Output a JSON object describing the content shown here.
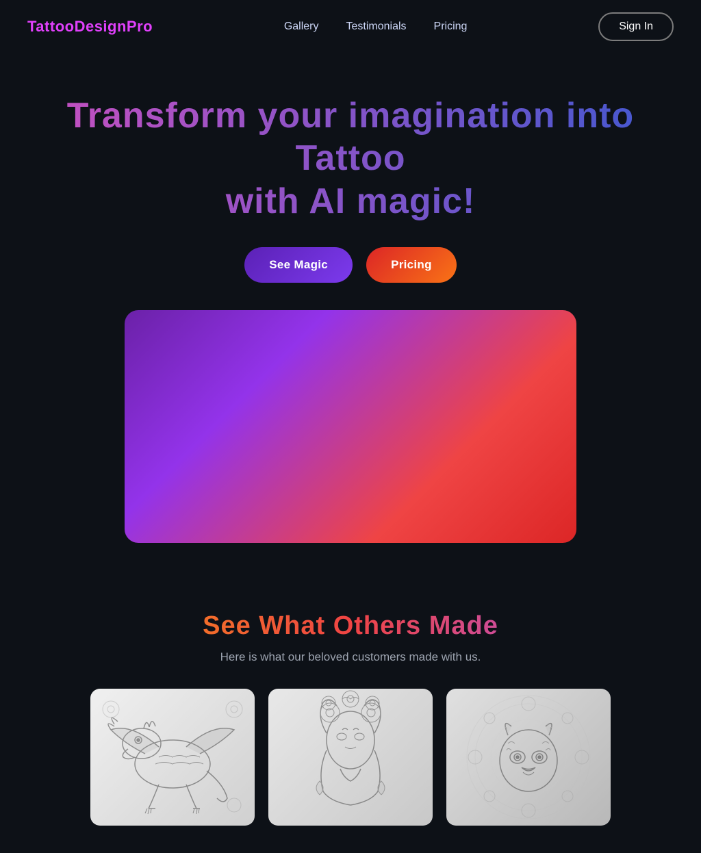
{
  "nav": {
    "logo": "TattooDesignPro",
    "links": [
      {
        "label": "Gallery",
        "href": "#gallery"
      },
      {
        "label": "Testimonials",
        "href": "#testimonials"
      },
      {
        "label": "Pricing",
        "href": "#pricing"
      }
    ],
    "signin_label": "Sign In"
  },
  "hero": {
    "title_line1": "Transform your imagination into Tattoo",
    "title_line2": "with AI magic!",
    "btn_magic": "See Magic",
    "btn_pricing": "Pricing"
  },
  "gallery": {
    "title": "See What Others Made",
    "subtitle": "Here is what our beloved customers made with us.",
    "cards": [
      {
        "id": "dragon",
        "alt": "Dragon tattoo sketch"
      },
      {
        "id": "woman",
        "alt": "Woman with flowers tattoo sketch"
      },
      {
        "id": "wolf",
        "alt": "Wolf mandala tattoo sketch"
      }
    ]
  }
}
